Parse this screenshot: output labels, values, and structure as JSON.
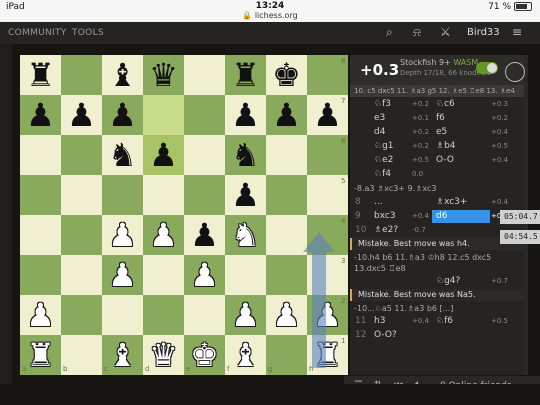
{
  "status": {
    "time": "13:24",
    "url": "lichess.org",
    "battery": "71 %",
    "battery_fill": 0.71
  },
  "nav": {
    "community": "COMMUNITY",
    "tools": "TOOLS",
    "username": "Bird33",
    "search_icon": "search-icon",
    "bell_icon": "bell-icon",
    "swords_icon": "swords-icon",
    "menu_icon": "menu-icon"
  },
  "board": {
    "ranks": [
      "8",
      "7",
      "6",
      "5",
      "4",
      "3",
      "2",
      "1"
    ],
    "files": [
      "a",
      "b",
      "c",
      "d",
      "e",
      "f",
      "g",
      "h"
    ],
    "highlights": [
      "d7",
      "d6"
    ],
    "pieces": {
      "a8": "br",
      "c8": "bb",
      "d8": "bq",
      "f8": "br",
      "g8": "bk",
      "a7": "bp",
      "b7": "bp",
      "c7": "bp",
      "f7": "bp",
      "g7": "bp",
      "h7": "bp",
      "c6": "bn",
      "d6": "bp",
      "f6": "bn",
      "f5": "bp",
      "c4": "wp",
      "d4": "wp",
      "e4": "bp",
      "f4": "wn",
      "c3": "wp",
      "e3": "wp",
      "a2": "wp",
      "f2": "wp",
      "g2": "wp",
      "h2": "wp",
      "a1": "wr",
      "c1": "wb",
      "d1": "wq",
      "e1": "wk",
      "f1": "wb",
      "h1": "wr"
    }
  },
  "engine": {
    "score": "+0.3",
    "name": "Stockfish 9+",
    "mode": "WASM",
    "depth": "Depth 17/18, 66 knodes/s",
    "pv": "10. c5 dxc5 11. ♗a3 g5 12. ♗e5 ♖e8 13. ♗e4"
  },
  "moves": [
    {
      "n": "",
      "w": "♘f3",
      "ws": "+0.2",
      "b": "♘c6",
      "bs": "+0.3"
    },
    {
      "n": "",
      "w": "e3",
      "ws": "+0.1",
      "b": "f6",
      "bs": "+0.2"
    },
    {
      "n": "",
      "w": "d4",
      "ws": "+0.2",
      "b": "e5",
      "bs": "+0.4"
    },
    {
      "n": "",
      "w": "♘g1",
      "ws": "+0.2",
      "b": "♗b4",
      "bs": "+0.5"
    },
    {
      "n": "",
      "w": "♘e2",
      "ws": "+0.5",
      "b": "O-O",
      "bs": "+0.4"
    },
    {
      "n": "",
      "w": "♘f4",
      "ws": "0.0",
      "b": "",
      "bs": ""
    }
  ],
  "variation1": "-8.a3 ♗xc3+ 9.♗xc3",
  "moves2": [
    {
      "n": "8",
      "w": "...",
      "ws": "",
      "b": "♗xc3+",
      "bs": "+0.4"
    },
    {
      "n": "9",
      "w": "bxc3",
      "ws": "+0.4",
      "b": "d6",
      "bs": "+0.3",
      "selected": true
    },
    {
      "n": "10",
      "w": "♗e2?",
      "ws": "-0.7",
      "b": "",
      "bs": ""
    }
  ],
  "comment1": "Mistake. Best move was h4.",
  "variation2": "-10.h4 b6 11.♗a3 ♔h8 12.c5 dxc5 13.dxc5 ♖e8",
  "moves3": [
    {
      "n": "",
      "w": "",
      "ws": "",
      "b": "♘g4?",
      "bs": "+0.7"
    }
  ],
  "comment2": "Mistake. Best move was Na5.",
  "variation3": "-10...♘a5 11.♗a3 b6 [...]",
  "moves4": [
    {
      "n": "11",
      "w": "h3",
      "ws": "+0.4",
      "b": "♘f6",
      "bs": "+0.5"
    },
    {
      "n": "12",
      "w": "O-O?",
      "ws": "",
      "b": "",
      "bs": ""
    }
  ],
  "clocks": [
    "05:04.7",
    "04:54.5"
  ],
  "friends": {
    "label": "0 Online friends"
  },
  "colors": {
    "light_square": "#f0f0d1",
    "dark_square": "#89a95d",
    "accent": "#3692e7",
    "bg": "#161512"
  }
}
